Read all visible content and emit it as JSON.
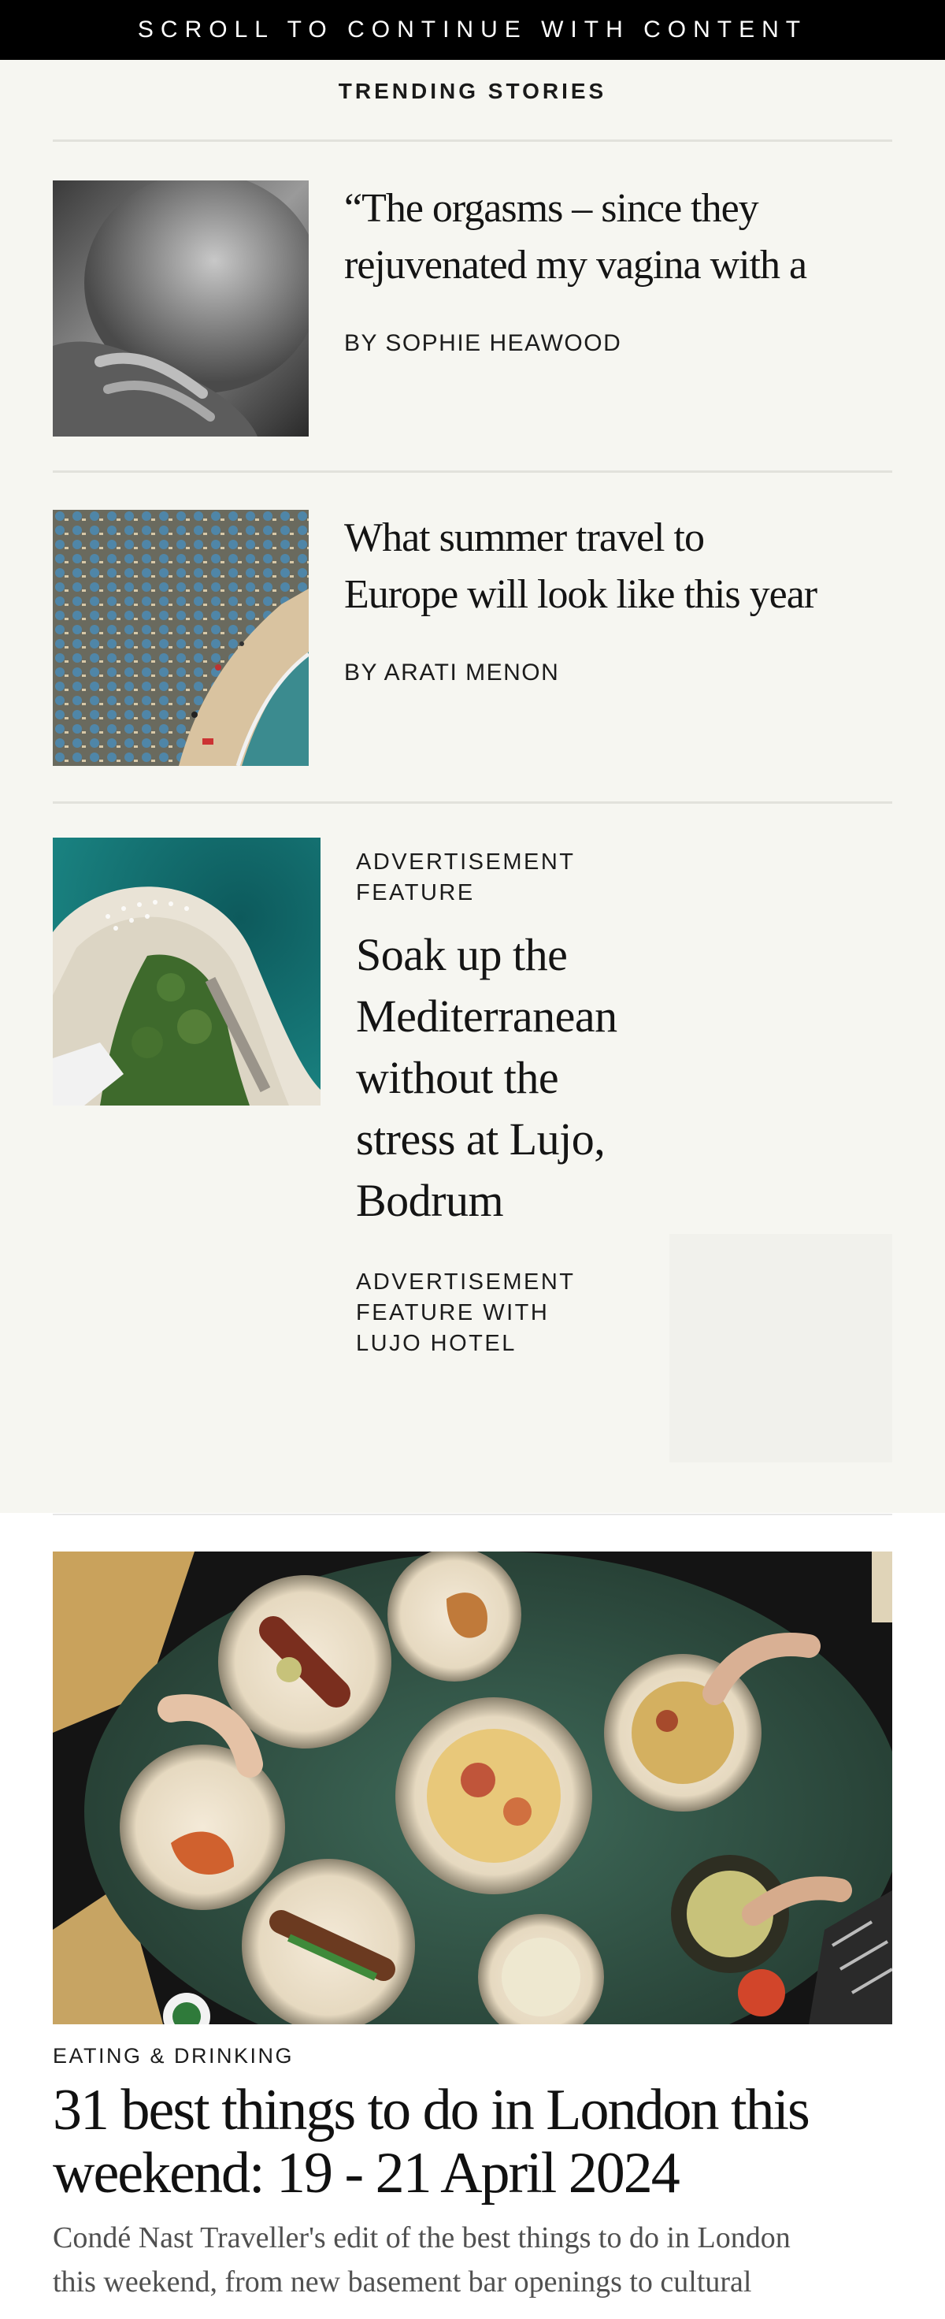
{
  "banner": {
    "text": "SCROLL TO CONTINUE WITH CONTENT"
  },
  "trending": {
    "title": "TRENDING STORIES",
    "stories": [
      {
        "headline_line1": "“The orgasms – since they",
        "headline_line2": "rejuvenated my vagina with a",
        "byline": "BY SOPHIE HEAWOOD"
      },
      {
        "headline_line1": "What summer travel to",
        "headline_line2": "Europe will look like this year",
        "byline": "BY ARATI MENON"
      }
    ],
    "ad": {
      "label_line1": "ADVERTISEMENT",
      "label_line2": "FEATURE",
      "headline_lines": [
        "Soak up the",
        "Mediterranean",
        "without the",
        "stress at Lujo,",
        "Bodrum"
      ],
      "sponsor_line1": "ADVERTISEMENT",
      "sponsor_line2": "FEATURE WITH",
      "sponsor_line3": "LUJO HOTEL"
    }
  },
  "feature": {
    "category": "EATING & DRINKING",
    "headline_line1": "31 best things to do in London this",
    "headline_line2": "weekend: 19 - 21 April 2024",
    "dek_line1": "Condé Nast Traveller's edit of the best things to do in London",
    "dek_line2": "this weekend, from new basement bar openings to cultural"
  }
}
